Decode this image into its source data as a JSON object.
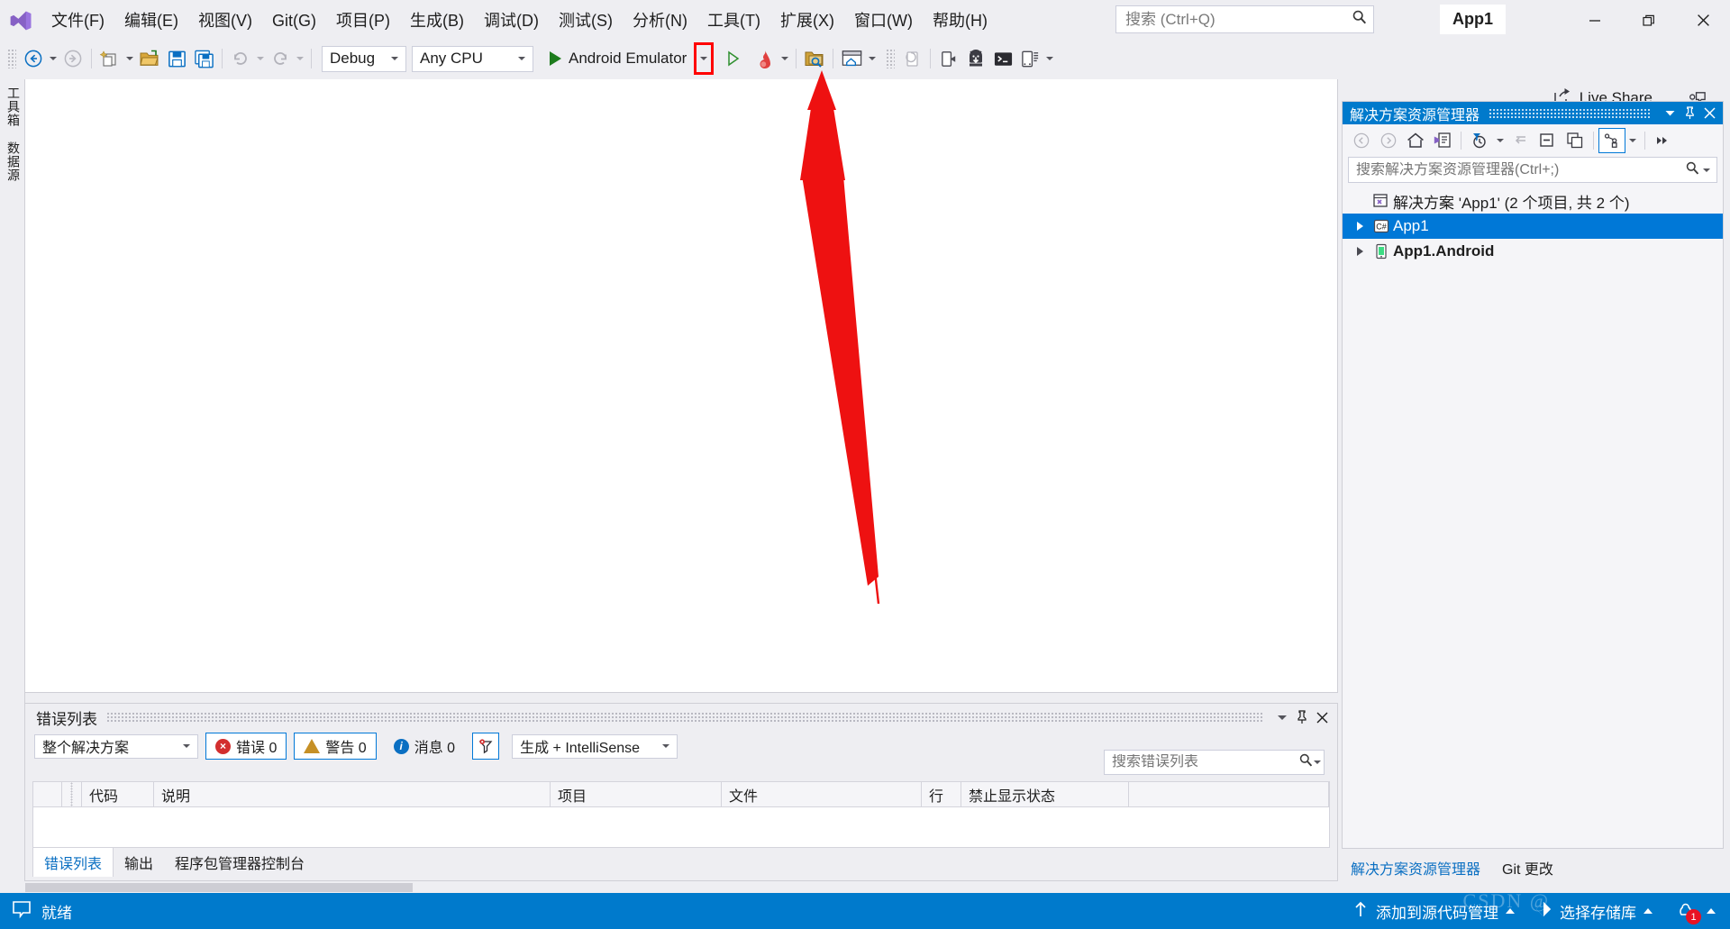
{
  "window": {
    "app_title": "App1",
    "minimize": "─",
    "maximize": "❐",
    "close": "✕"
  },
  "menu": {
    "items": [
      {
        "label": "文件(F)",
        "name": "menu-file"
      },
      {
        "label": "编辑(E)",
        "name": "menu-edit"
      },
      {
        "label": "视图(V)",
        "name": "menu-view"
      },
      {
        "label": "Git(G)",
        "name": "menu-git"
      },
      {
        "label": "项目(P)",
        "name": "menu-project"
      },
      {
        "label": "生成(B)",
        "name": "menu-build"
      },
      {
        "label": "调试(D)",
        "name": "menu-debug"
      },
      {
        "label": "测试(S)",
        "name": "menu-test"
      },
      {
        "label": "分析(N)",
        "name": "menu-analyze"
      },
      {
        "label": "工具(T)",
        "name": "menu-tools"
      },
      {
        "label": "扩展(X)",
        "name": "menu-extensions"
      },
      {
        "label": "窗口(W)",
        "name": "menu-window"
      },
      {
        "label": "帮助(H)",
        "name": "menu-help"
      }
    ]
  },
  "quick_search": {
    "placeholder": "搜索 (Ctrl+Q)",
    "value": "",
    "icon": "search-icon"
  },
  "toolbar": {
    "back_icon": "navigate-back-icon",
    "forward_icon": "navigate-forward-icon",
    "new_project_icon": "new-project-icon",
    "open_file_icon": "open-file-icon",
    "save_icon": "save-icon",
    "save_all_icon": "save-all-icon",
    "undo_icon": "undo-icon",
    "redo_icon": "redo-icon",
    "configuration": "Debug",
    "platform": "Any CPU",
    "start_target": "Android Emulator",
    "start_icon": "play-icon",
    "start_dropdown_icon": "chevron-down-icon",
    "attach_icon": "attach-to-process-icon",
    "hot_reload_icon": "hot-reload-flame-icon",
    "search_solution_icon": "folder-search-icon",
    "layout_icon": "window-layout-icon",
    "refresh_device_icon": "refresh-device-icon",
    "deploy_icon": "deploy-to-device-icon",
    "android_sdk_icon": "android-sdk-manager-icon",
    "adb_console_icon": "adb-console-icon",
    "device_manager_icon": "android-device-manager-icon",
    "overflow_icon": "toolbar-overflow-icon",
    "live_share_label": "Live Share",
    "live_share_icon": "live-share-icon",
    "feedback_icon": "send-feedback-icon"
  },
  "left_tabs": [
    {
      "label": "工具箱",
      "name": "sidebar-tab-toolbox"
    },
    {
      "label": "数据源",
      "name": "sidebar-tab-datasources"
    }
  ],
  "error_list": {
    "title": "错误列表",
    "scope": "整个解决方案",
    "errors_label": "错误 0",
    "warnings_label": "警告 0",
    "messages_label": "消息 0",
    "filter_icon": "error-filter-icon",
    "build_filter": "生成 + IntelliSense",
    "search_placeholder": "搜索错误列表",
    "search_value": "",
    "columns": [
      "",
      "",
      "代码",
      "说明",
      "项目",
      "文件",
      "行",
      "禁止显示状态",
      ""
    ],
    "rows": [],
    "tabs": [
      {
        "label": "错误列表",
        "active": true,
        "name": "tab-error-list"
      },
      {
        "label": "输出",
        "active": false,
        "name": "tab-output"
      },
      {
        "label": "程序包管理器控制台",
        "active": false,
        "name": "tab-package-manager-console"
      }
    ],
    "dropdown_icon": "chevron-down-icon",
    "pin_icon": "pin-icon",
    "close_icon": "close-icon"
  },
  "solution_explorer": {
    "title": "解决方案资源管理器",
    "search_placeholder": "搜索解决方案资源管理器(Ctrl+;)",
    "search_value": "",
    "toolbar_icons": [
      "back-icon",
      "forward-icon",
      "home-icon",
      "sync-with-active-document-icon",
      "pending-changes-filter-icon",
      "chevron-down-icon",
      "refresh-icon",
      "collapse-all-icon",
      "show-all-files-icon",
      "view-code-icon",
      "chevron-down-icon",
      "overflow-icon"
    ],
    "tree": [
      {
        "label": "解决方案 'App1' (2 个项目, 共 2 个)",
        "icon": "solution-icon",
        "indent": 0,
        "selected": false,
        "bold": false,
        "expander": false
      },
      {
        "label": "App1",
        "icon": "csharp-project-icon",
        "indent": 1,
        "selected": true,
        "bold": false,
        "expander": true
      },
      {
        "label": "App1.Android",
        "icon": "android-project-icon",
        "indent": 1,
        "selected": false,
        "bold": true,
        "expander": true
      }
    ],
    "bottom_tabs": [
      {
        "label": "解决方案资源管理器",
        "active": true,
        "name": "tab-solution-explorer"
      },
      {
        "label": "Git 更改",
        "active": false,
        "name": "tab-git-changes"
      }
    ]
  },
  "status_bar": {
    "ready_label": "就绪",
    "ready_icon": "status-ready-icon",
    "add_to_source_control": "添加到源代码管理",
    "select_repository": "选择存储库",
    "up_arrow_icon": "arrow-up-icon",
    "git_icon": "git-repository-icon",
    "notification_count": "1",
    "notification_icon": "bell-icon",
    "watermark": "CSDN @"
  },
  "annotation": {
    "arrow_color": "#ee1111",
    "highlight_color": "#ff0000",
    "target": "start-target-dropdown"
  }
}
